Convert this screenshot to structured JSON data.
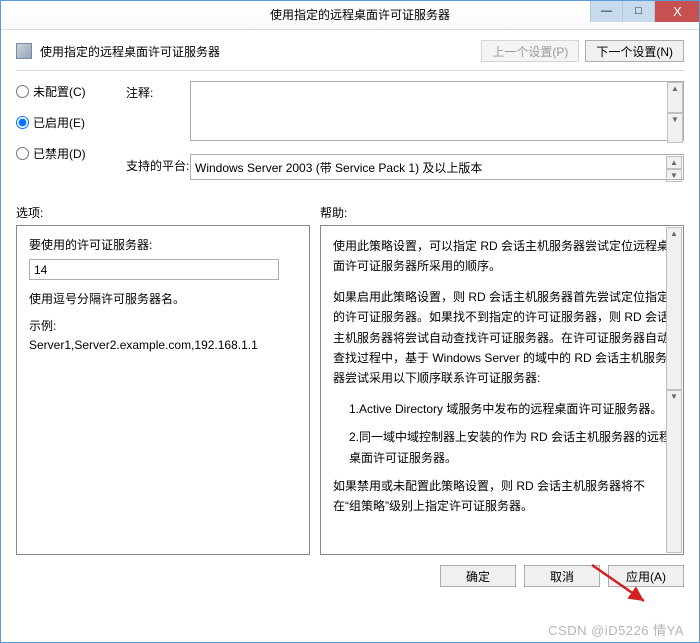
{
  "window": {
    "title": "使用指定的远程桌面许可证服务器",
    "minimize_glyph": "—",
    "maximize_glyph": "□",
    "close_glyph": "X"
  },
  "header": {
    "text": "使用指定的远程桌面许可证服务器",
    "prev_btn": "上一个设置(P)",
    "next_btn": "下一个设置(N)"
  },
  "radios": {
    "not_configured": "未配置(C)",
    "enabled": "已启用(E)",
    "disabled": "已禁用(D)",
    "selected": "enabled"
  },
  "fields": {
    "comment_label": "注释:",
    "comment_value": "",
    "platform_label": "支持的平台:",
    "platform_value": "Windows Server 2003 (带 Service Pack 1) 及以上版本"
  },
  "section_labels": {
    "options": "选项:",
    "help": "帮助:"
  },
  "options": {
    "server_label": "要使用的许可证服务器:",
    "server_value": "14",
    "hint1": "使用逗号分隔许可服务器名。",
    "hint2": "示例:",
    "example": "Server1,Server2.example.com,192.168.1.1"
  },
  "help": {
    "p1": "使用此策略设置，可以指定 RD 会话主机服务器尝试定位远程桌面许可证服务器所采用的顺序。",
    "p2": "如果启用此策略设置，则 RD 会话主机服务器首先尝试定位指定的许可证服务器。如果找不到指定的许可证服务器，则 RD 会话主机服务器将尝试自动查找许可证服务器。在许可证服务器自动查找过程中，基于 Windows Server 的域中的 RD 会话主机服务器尝试采用以下顺序联系许可证服务器:",
    "li1": "1.Active Directory 域服务中发布的远程桌面许可证服务器。",
    "li2": "2.同一域中域控制器上安装的作为 RD 会话主机服务器的远程桌面许可证服务器。",
    "p3": "如果禁用或未配置此策略设置，则 RD 会话主机服务器将不在“组策略”级别上指定许可证服务器。"
  },
  "footer": {
    "ok": "确定",
    "cancel": "取消",
    "apply": "应用(A)"
  },
  "watermark": "CSDN @iD5226 情YA"
}
